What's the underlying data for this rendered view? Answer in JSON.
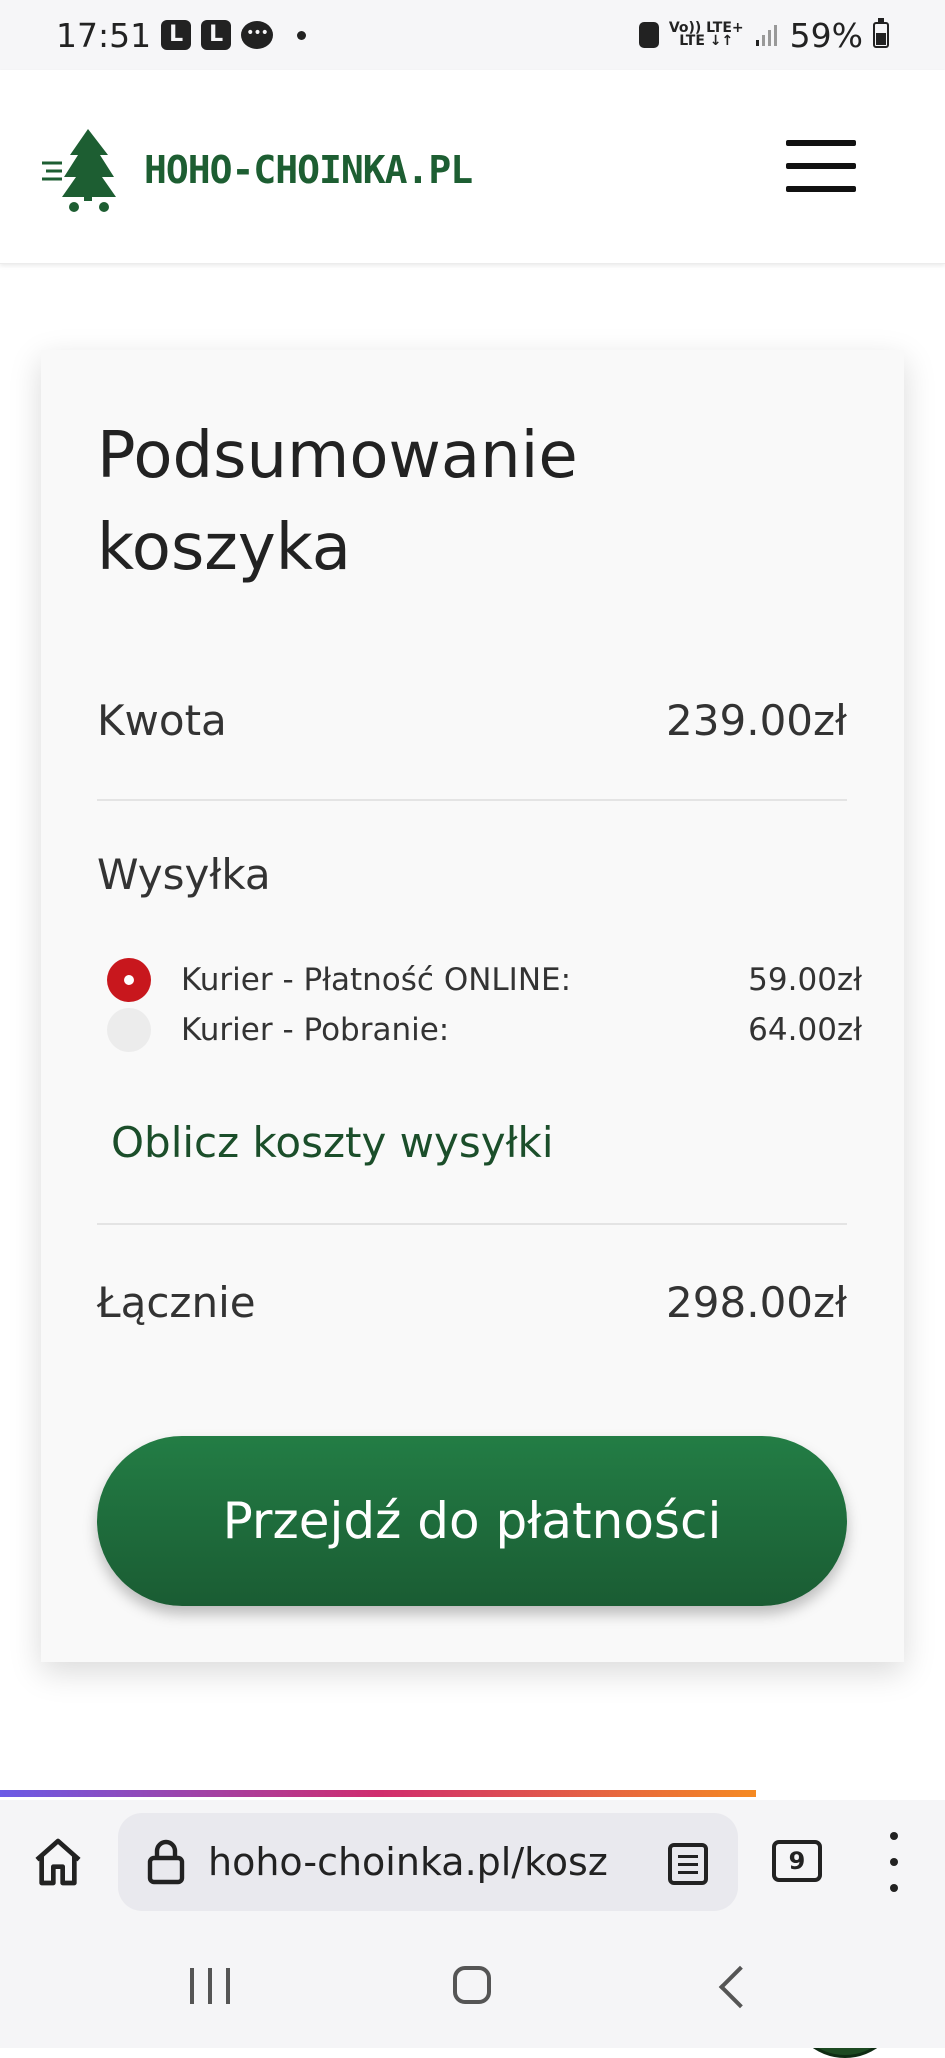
{
  "status_bar": {
    "time": "17:51",
    "battery": "59%",
    "network_top": "Vo)) LTE+",
    "network_bottom": "LTE ↓↑"
  },
  "header": {
    "logo_text": "HOHO-CHOINKA.PL",
    "brand_color": "#1d5e32"
  },
  "cart": {
    "title": "Podsumowanie koszyka",
    "amount_label": "Kwota",
    "amount_value": "239.00zł",
    "shipping_label": "Wysyłka",
    "shipping_options": [
      {
        "label": "Kurier - Płatność ONLINE:",
        "price": "59.00zł",
        "selected": true
      },
      {
        "label": "Kurier - Pobranie:",
        "price": "64.00zł",
        "selected": false
      }
    ],
    "calc_shipping_link": "Oblicz koszty wysyłki",
    "total_label": "Łącznie",
    "total_value": "298.00zł",
    "checkout_button": "Przejdź do płatności",
    "accent_red": "#c8171d",
    "button_green": "#1f6e3c"
  },
  "browser": {
    "url": "hoho-choinka.pl/koszyk",
    "tab_count": "9",
    "load_progress": 0.8
  }
}
